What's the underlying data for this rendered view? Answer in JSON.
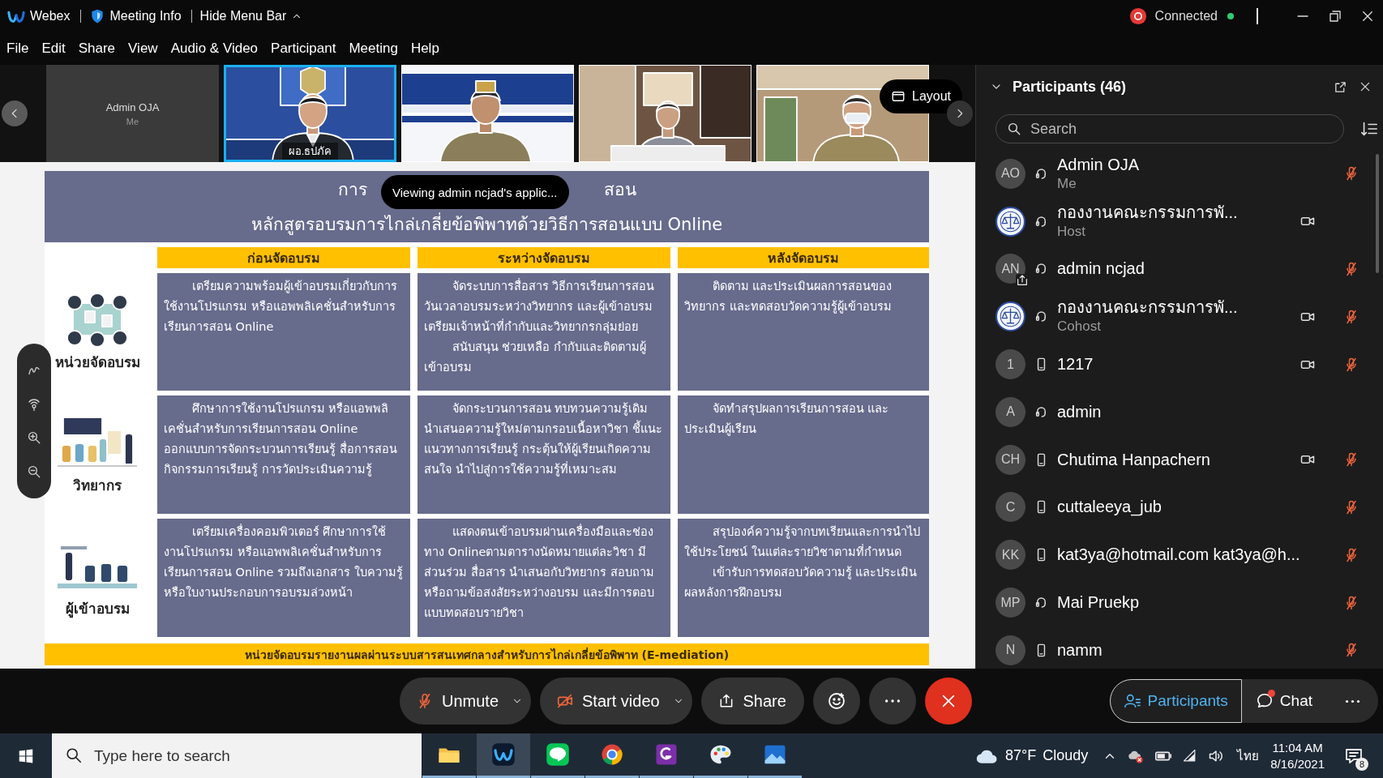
{
  "title_bar": {
    "app_name": "Webex",
    "meeting_info": "Meeting Info",
    "hide_menu": "Hide Menu Bar",
    "status": "Connected",
    "connected": true
  },
  "menu": [
    "File",
    "Edit",
    "Share",
    "View",
    "Audio & Video",
    "Participant",
    "Meeting",
    "Help"
  ],
  "video_strip": {
    "tiles": [
      {
        "kind": "avatar",
        "name": "Admin OJA",
        "subtitle": "Me",
        "selected": false
      },
      {
        "kind": "picture",
        "label": "ผอ.ธปภัค",
        "selected": true
      },
      {
        "kind": "picture",
        "selected": false
      },
      {
        "kind": "picture",
        "selected": false
      },
      {
        "kind": "picture",
        "selected": false
      }
    ],
    "layout_button": "Layout"
  },
  "share_toast": "Viewing admin ncjad's applic...",
  "slide": {
    "title_parts": [
      "การ",
      "สอน"
    ],
    "subtitle": "หลักสูตรอบรมการไกล่เกลี่ยข้อพิพาทด้วยวิธีการสอนแบบ Online",
    "columns": [
      "ก่อนจัดอบรม",
      "ระหว่างจัดอบรม",
      "หลังจัดอบรม"
    ],
    "rows": [
      {
        "label": "หน่วยจัดอบรม",
        "cells": [
          [
            "เตรียมความพร้อมผู้เข้าอบรมเกี่ยวกับการใช้งานโปรแกรม หรือแอพพลิเคชั่นสำหรับการเรียนการสอน Online"
          ],
          [
            "จัดระบบการสื่อสาร วิธีการเรียนการสอน วันเวลาอบรมระหว่างวิทยากร และผู้เข้าอบรม เตรียมเจ้าหน้าที่กำกับและวิทยากรกลุ่มย่อย",
            "สนับสนุน ช่วยเหลือ กำกับและติดตามผู้เข้าอบรม"
          ],
          [
            "ติดตาม และประเมินผลการสอนของวิทยากร และทดสอบวัดความรู้ผู้เข้าอบรม"
          ]
        ]
      },
      {
        "label": "วิทยากร",
        "cells": [
          [
            "ศึกษาการใช้งานโปรแกรม หรือแอพพลิเคชั่นสำหรับการเรียนการสอน Online ออกแบบการจัดกระบวนการเรียนรู้ สื่อการสอน กิจกรรมการเรียนรู้ การวัดประเมินความรู้"
          ],
          [
            "จัดกระบวนการสอน ทบทวนความรู้เดิม นำเสนอความรู้ใหม่ตามกรอบเนื้อหาวิชา ชี้แนะแนวทางการเรียนรู้ กระตุ้นให้ผู้เรียนเกิดความสนใจ นำไปสู่การใช้ความรู้ที่เหมาะสม"
          ],
          [
            "จัดทำสรุปผลการเรียนการสอน และประเมินผู้เรียน"
          ]
        ]
      },
      {
        "label": "ผู้เข้าอบรม",
        "cells": [
          [
            "เตรียมเครื่องคอมพิวเตอร์ ศึกษาการใช้งานโปรแกรม หรือแอพพลิเคชั่นสำหรับการเรียนการสอน Online รวมถึงเอกสาร ใบความรู้หรือใบงานประกอบการอบรมล่วงหน้า"
          ],
          [
            "แสดงตนเข้าอบรมผ่านเครื่องมือและช่องทาง Onlineตามตารางนัดหมายแต่ละวิชา มีส่วนร่วม สื่อสาร นำเสนอกับวิทยากร สอบถามหรือถามข้อสงสัยระหว่างอบรม และมีการตอบแบบทดสอบรายวิชา"
          ],
          [
            "สรุปองค์ความรู้จากบทเรียนและการนำไปใช้ประโยชน์ ในแต่ละรายวิชาตามที่กำหนด",
            "เข้ารับการทดสอบวัดความรู้ และประเมินผลหลังการฝึกอบรม"
          ]
        ]
      }
    ],
    "footer": "หน่วยจัดอบรมรายงานผลผ่านระบบสารสนเทศกลางสำหรับการไกล่เกลี่ยข้อพิพาท (E-mediation)"
  },
  "participants": {
    "title": "Participants (46)",
    "search_placeholder": "Search",
    "items": [
      {
        "avatar": {
          "kind": "initials",
          "initials": "AO"
        },
        "device": {
          "kind": "headset"
        },
        "name": "Admin OJA",
        "role": "Me",
        "sharing": false,
        "video": false,
        "muted": true
      },
      {
        "avatar": {
          "kind": "logo"
        },
        "device": {
          "kind": "headset"
        },
        "name": "กองงานคณะกรรมการพั...",
        "role": "Host",
        "sharing": false,
        "video": true,
        "muted": false
      },
      {
        "avatar": {
          "kind": "initials",
          "initials": "AN"
        },
        "device": {
          "kind": "headset"
        },
        "name": "admin ncjad",
        "sharing": true,
        "video": false,
        "muted": true
      },
      {
        "avatar": {
          "kind": "logo"
        },
        "device": {
          "kind": "headset"
        },
        "name": "กองงานคณะกรรมการพั...",
        "role": "Cohost",
        "sharing": false,
        "video": true,
        "muted": true
      },
      {
        "avatar": {
          "kind": "initials",
          "initials": "1"
        },
        "device": {
          "kind": "phone"
        },
        "name": "1217",
        "sharing": false,
        "video": true,
        "muted": true
      },
      {
        "avatar": {
          "kind": "initials",
          "initials": "A"
        },
        "device": {
          "kind": "headset"
        },
        "name": "admin",
        "sharing": false,
        "video": false,
        "muted": false
      },
      {
        "avatar": {
          "kind": "initials",
          "initials": "CH"
        },
        "device": {
          "kind": "phone"
        },
        "name": "Chutima Hanpachern",
        "sharing": false,
        "video": true,
        "muted": true
      },
      {
        "avatar": {
          "kind": "initials",
          "initials": "C"
        },
        "device": {
          "kind": "phone"
        },
        "name": "cuttaleeya_jub",
        "sharing": false,
        "video": false,
        "muted": true
      },
      {
        "avatar": {
          "kind": "initials",
          "initials": "KK"
        },
        "device": {
          "kind": "phone"
        },
        "name": "kat3ya@hotmail.com kat3ya@h...",
        "sharing": false,
        "video": false,
        "muted": true
      },
      {
        "avatar": {
          "kind": "initials",
          "initials": "MP"
        },
        "device": {
          "kind": "headset"
        },
        "name": "Mai Pruekp",
        "sharing": false,
        "video": false,
        "muted": true
      },
      {
        "avatar": {
          "kind": "initials",
          "initials": "N"
        },
        "device": {
          "kind": "phone"
        },
        "name": "namm",
        "sharing": false,
        "video": false,
        "muted": true
      }
    ]
  },
  "controls": [
    {
      "kind": "audio",
      "label": "Unmute",
      "muted": true
    },
    {
      "kind": "video",
      "label": "Start video",
      "off": true
    },
    {
      "kind": "share",
      "label": "Share"
    },
    {
      "kind": "reactions"
    },
    {
      "kind": "more"
    },
    {
      "kind": "leave"
    }
  ],
  "side_buttons": [
    {
      "kind": "participants",
      "label": "Participants",
      "selected": true
    },
    {
      "kind": "chat",
      "label": "Chat",
      "selected": false,
      "unread": true
    },
    {
      "kind": "more",
      "selected": false
    }
  ],
  "taskbar": {
    "search_placeholder": "Type here to search",
    "apps": [
      {
        "kind": "folder",
        "active": false
      },
      {
        "kind": "webex",
        "active": true
      },
      {
        "kind": "line",
        "active": false
      },
      {
        "kind": "browser",
        "active": false
      },
      {
        "kind": "pdf",
        "active": false
      },
      {
        "kind": "paint",
        "active": false
      },
      {
        "kind": "photos",
        "active": false
      }
    ],
    "temperature": "87°F",
    "weather": "Cloudy",
    "language": "ไทย",
    "time": "11:04 AM",
    "date": "8/16/2021",
    "notifications": "8"
  }
}
